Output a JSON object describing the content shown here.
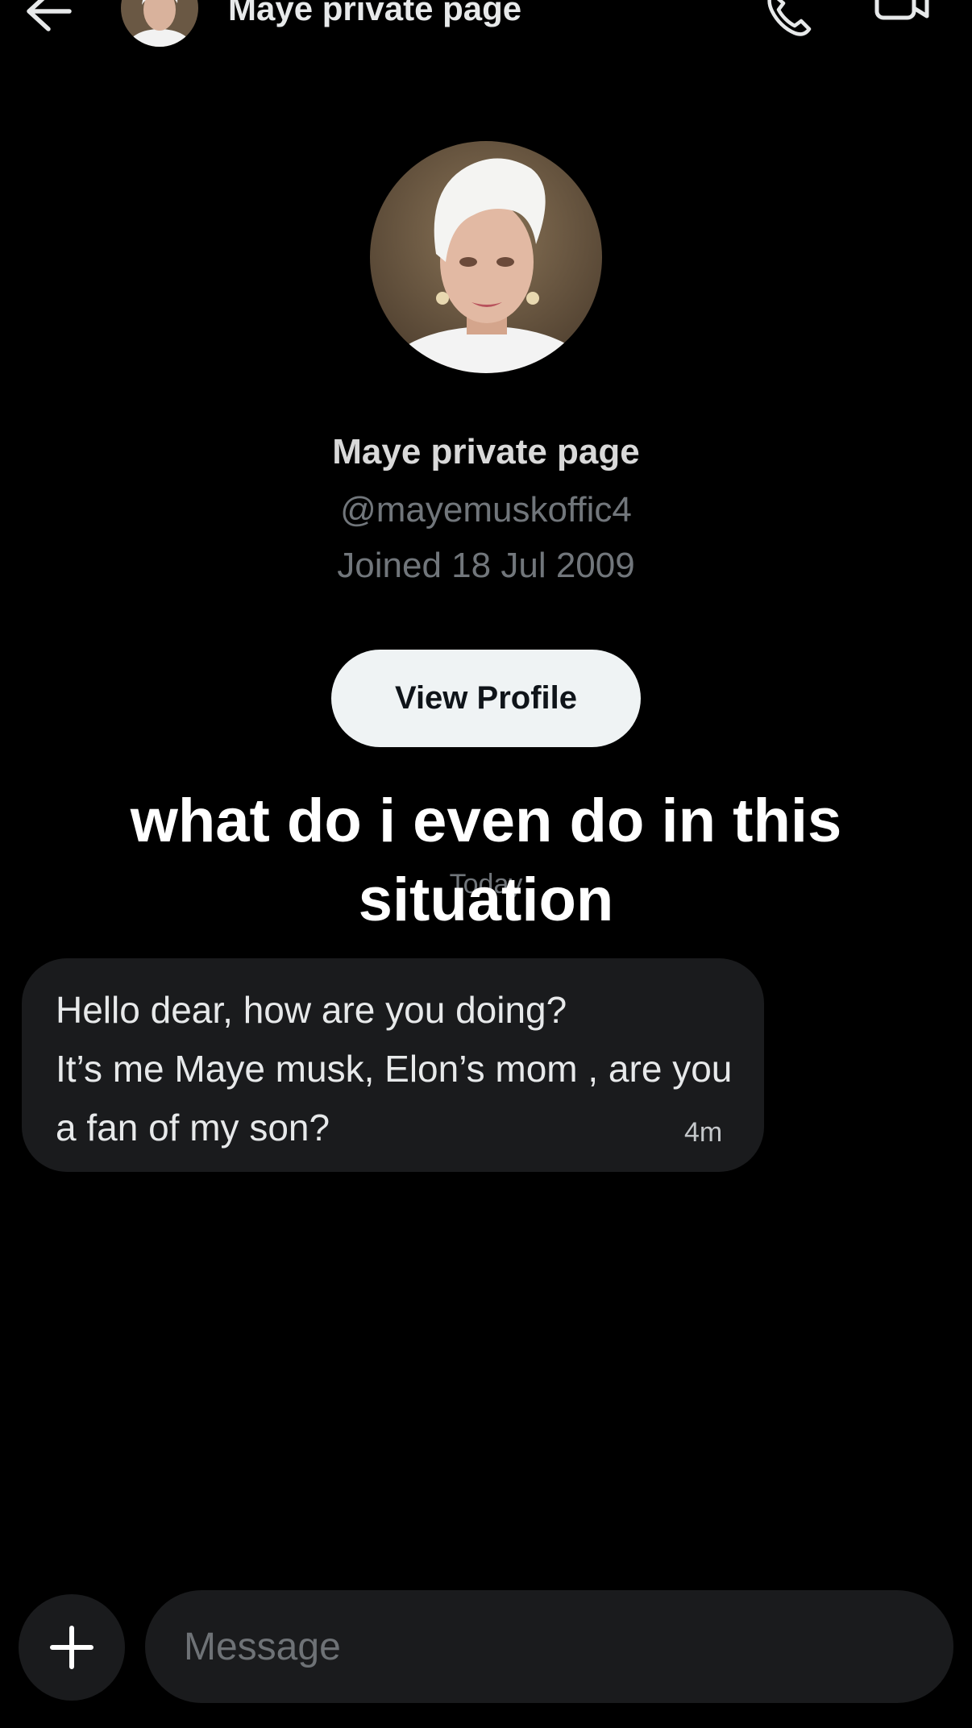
{
  "header": {
    "title": "Maye private page",
    "back_icon": "arrow-left-icon",
    "call_icon": "phone-icon",
    "video_icon": "video-camera-icon"
  },
  "profile": {
    "name": "Maye private page",
    "handle": "@mayemuskoffic4",
    "joined": "Joined 18 Jul 2009",
    "view_profile_label": "View Profile"
  },
  "conversation": {
    "day_separator": "Today",
    "messages": [
      {
        "text": "Hello dear, how are you doing?\nIt’s me Maye musk, Elon’s mom , are you a fan of my son?",
        "time": "4m"
      }
    ]
  },
  "overlay": {
    "caption": "what do i even do in this situation"
  },
  "composer": {
    "placeholder": "Message",
    "add_icon": "plus-icon"
  },
  "colors": {
    "background": "#000000",
    "bubble": "#1a1b1d",
    "button_bg": "#eff3f4",
    "muted_text": "#71767b"
  }
}
